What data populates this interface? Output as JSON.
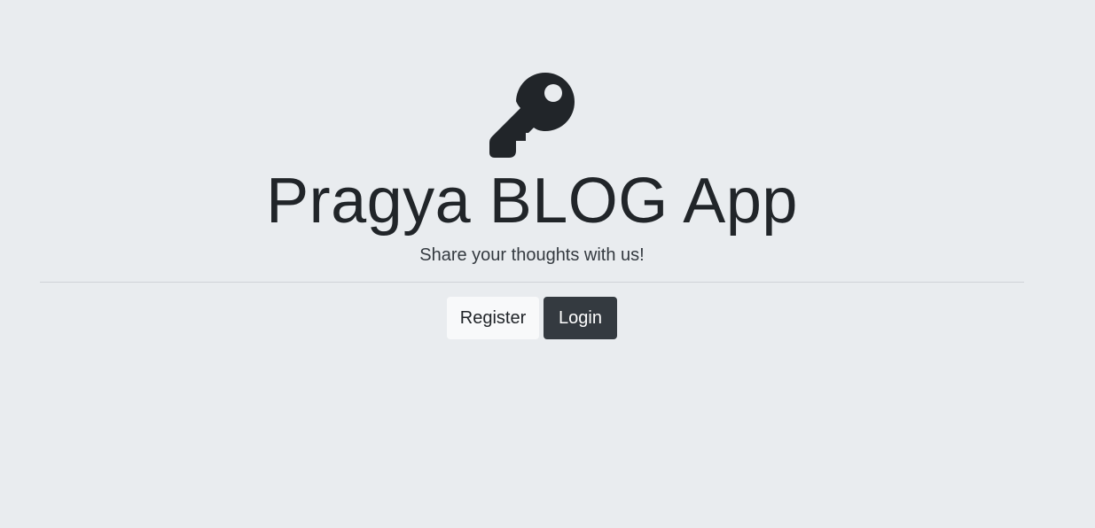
{
  "jumbotron": {
    "icon": "key-icon",
    "title": "Pragya BLOG App",
    "lead": "Share your thoughts with us!"
  },
  "actions": {
    "register_label": "Register",
    "login_label": "Login"
  },
  "colors": {
    "background": "#e9ecef",
    "text": "#212529",
    "register_button": "#f8f9fa",
    "login_button": "#343a40"
  }
}
